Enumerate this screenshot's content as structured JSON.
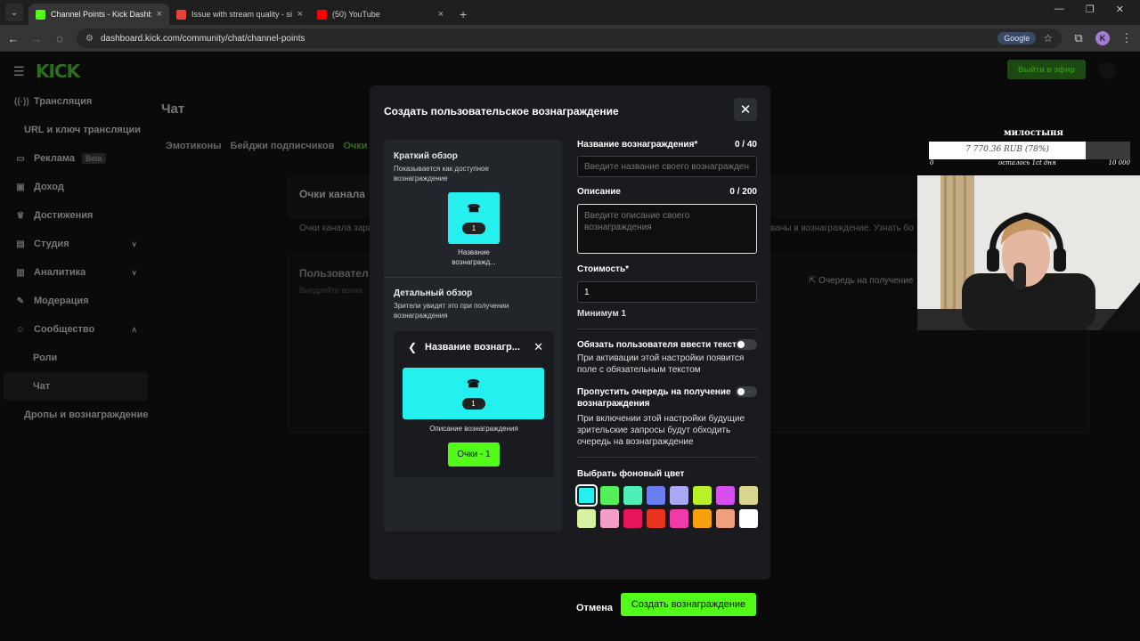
{
  "browser": {
    "tabs": [
      {
        "title": "Channel Points - Kick Dashboard",
        "favicon_color": "#53fc18",
        "active": true
      },
      {
        "title": "Issue with stream quality - sitisc",
        "favicon_color": "#ea4335",
        "active": false
      },
      {
        "title": "(50) YouTube",
        "favicon_color": "#ff0000",
        "active": false
      }
    ],
    "url": "dashboard.kick.com/community/chat/channel-points",
    "search_chip": "Google",
    "profile_initial": "K"
  },
  "app": {
    "logo": "KICK",
    "go_live": "Выйти в эфир",
    "sidebar": [
      {
        "label": "Трансляция",
        "icon": "broadcast-icon"
      },
      {
        "label": "URL и ключ трансляции",
        "icon": ""
      },
      {
        "label": "Реклама",
        "icon": "ads-icon",
        "badge": "Beta"
      },
      {
        "label": "Доход",
        "icon": "income-icon"
      },
      {
        "label": "Достижения",
        "icon": "trophy-icon"
      },
      {
        "label": "Студия",
        "icon": "studio-icon",
        "chevron": "down"
      },
      {
        "label": "Аналитика",
        "icon": "analytics-icon",
        "chevron": "down"
      },
      {
        "label": "Модерация",
        "icon": "moderation-icon"
      },
      {
        "label": "Сообщество",
        "icon": "community-icon",
        "chevron": "up"
      },
      {
        "label": "Роли",
        "icon": ""
      },
      {
        "label": "Чат",
        "icon": "",
        "selected": true
      },
      {
        "label": "Дропы и вознаграждение",
        "icon": ""
      }
    ],
    "page_title": "Чат",
    "tabs": [
      "Эмотиконы",
      "Бейджи подписчиков",
      "Очки"
    ],
    "card1_title": "Очки канала",
    "card1_text_left": "Очки канала зара",
    "card1_text_right": "ваны в вознаграждение. Узнать бо",
    "card2_title": "Пользовател",
    "card2_sub": "Внедряйте возна",
    "queue_link": "Очередь на получение"
  },
  "modal": {
    "title": "Создать пользовательское вознаграждение",
    "preview": {
      "short_title": "Краткий обзор",
      "short_desc": "Показывается как доступное вознаграждение",
      "tile_cost": "1",
      "tile_name": "Название вознагражд...",
      "detail_title": "Детальный обзор",
      "detail_desc": "Зрители увидят это при получении вознаграждения",
      "detail_header": "Название вознагр...",
      "detail_reward_desc": "Описание вознаграждения",
      "points_button": "Очки - 1"
    },
    "form": {
      "name_label": "Название вознаграждения*",
      "name_count": "0 / 40",
      "name_placeholder": "Введите название своего вознагражден",
      "desc_label": "Описание",
      "desc_count": "0 / 200",
      "desc_placeholder": "Введите описание своего вознаграждения",
      "cost_label": "Стоимость*",
      "cost_value": "1",
      "cost_min": "Минимум 1",
      "toggle1_label": "Обязать пользователя ввести текст",
      "toggle1_desc": "При активации этой настройки появится поле с обязательным текстом",
      "toggle2_label": "Пропустить очередь на получение вознаграждения",
      "toggle2_desc": "При включении этой настройки будущие зрительские запросы будут обходить очередь на вознаграждение",
      "color_label": "Выбрать фоновый цвет",
      "colors": [
        "#24f0f0",
        "#53f05a",
        "#4ff0b8",
        "#6b7ef0",
        "#a9a8f5",
        "#b9f02a",
        "#d84ff0",
        "#d9d48e",
        "#d6f2a0",
        "#f09ec8",
        "#e8155e",
        "#e8341c",
        "#f03aa8",
        "#f5a00c",
        "#f0a07c",
        "#ffffff"
      ],
      "selected_color": 0,
      "cancel": "Отмена",
      "create": "Создать вознаграждение"
    }
  },
  "donation_widget": {
    "title": "милостыня",
    "amount": "7 770.36 RUB (78%)",
    "progress_percent": 78,
    "left_label": "0",
    "middle_label": "осталось 1ct дня",
    "right_label": "10 000"
  }
}
